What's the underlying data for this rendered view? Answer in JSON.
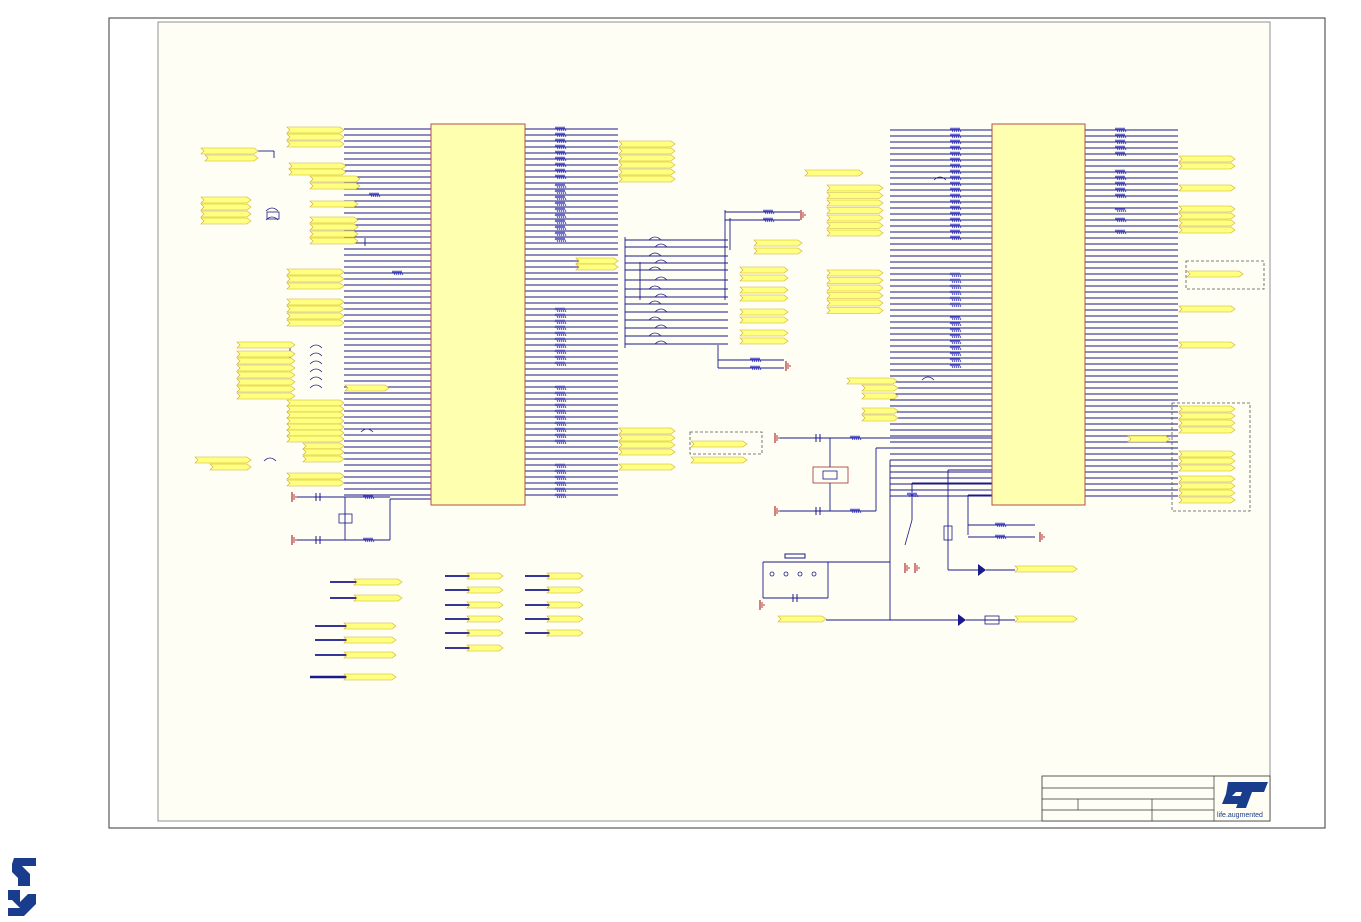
{
  "document": {
    "type": "schematic-sheet",
    "page_logo_icon": "st-logo-icon",
    "title_block_logo_icon": "st-logo-icon",
    "title_block_tagline": "life.augmented"
  },
  "colors": {
    "page_background": "#ffffff",
    "sheet_background": "#fffef4",
    "border": "#3a3a3a",
    "ic_fill": "#ffffb0",
    "ic_stroke": "#b05050",
    "wire": "#1a1a8c",
    "resistor": "#2a2ac0",
    "port_fill": "#ffff80",
    "port_stroke": "#d0b030",
    "ground": "#b03030",
    "st_blue": "#1a3c8c",
    "dashed_box": "#555555"
  }
}
